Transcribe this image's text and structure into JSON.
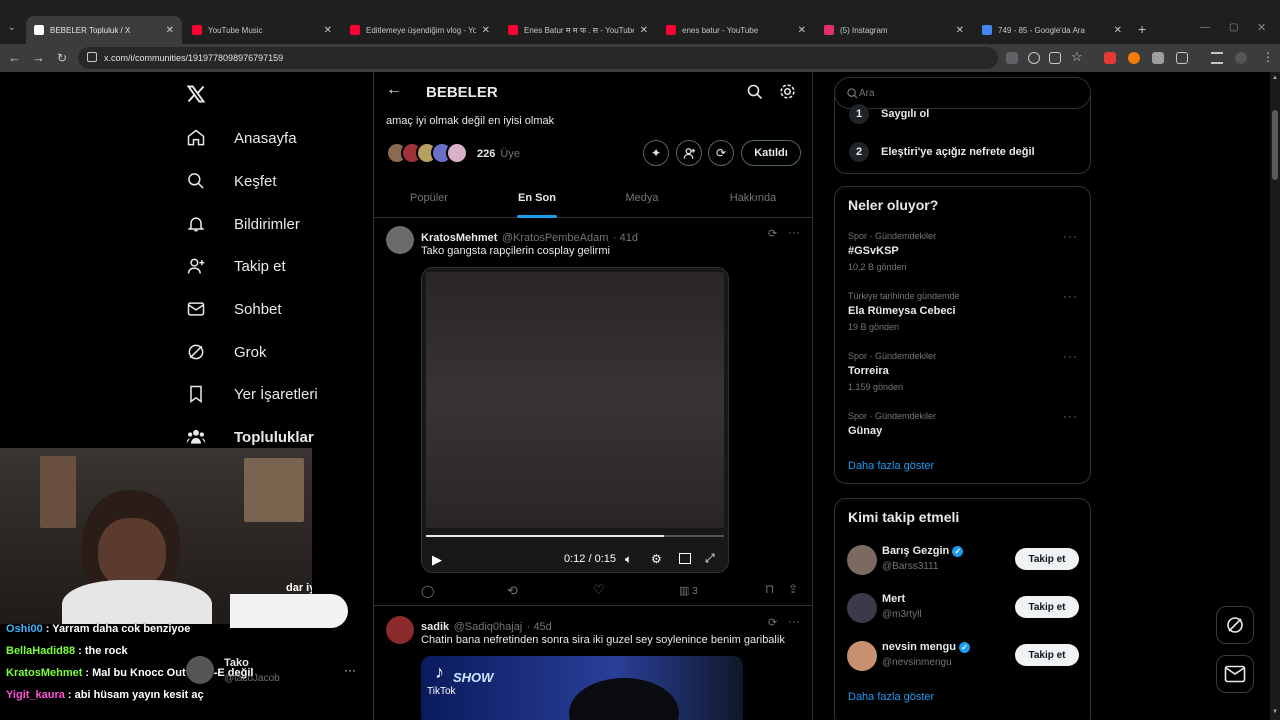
{
  "browser": {
    "tabs": [
      {
        "title": "BEBELER Topluluk / X",
        "favicon_color": "#ffffff",
        "active": true
      },
      {
        "title": "YouTube Music",
        "favicon_color": "#ff0033",
        "active": false
      },
      {
        "title": "Editlemeye üşendiğim vlog - Yo",
        "favicon_color": "#ff0033",
        "active": false
      },
      {
        "title": "Enes Batur म म फ . स - YouTube",
        "favicon_color": "#ff0033",
        "active": false
      },
      {
        "title": "enes batur - YouTube",
        "favicon_color": "#ff0033",
        "active": false
      },
      {
        "title": "(5) Instagram",
        "favicon_color": "#e1306c",
        "active": false
      },
      {
        "title": "749 - 85 - Google'da Ara",
        "favicon_color": "#4285f4",
        "active": false
      }
    ],
    "url": "x.com/i/communities/1919778098976797159"
  },
  "nav": {
    "items": [
      {
        "label": "Anasayfa",
        "icon": "home-icon"
      },
      {
        "label": "Keşfet",
        "icon": "search-icon"
      },
      {
        "label": "Bildirimler",
        "icon": "bell-icon"
      },
      {
        "label": "Takip et",
        "icon": "person-add-icon"
      },
      {
        "label": "Sohbet",
        "icon": "mail-icon"
      },
      {
        "label": "Grok",
        "icon": "grok-icon"
      },
      {
        "label": "Yer İşaretleri",
        "icon": "bookmark-icon"
      },
      {
        "label": "Topluluklar",
        "icon": "communities-icon"
      }
    ]
  },
  "community": {
    "name": "BEBELER",
    "description": "amaç iyi olmak değil en iyisi olmak",
    "member_count": "226",
    "member_label": "Üye",
    "joined_label": "Katıldı",
    "tabs": [
      "Popüler",
      "En Son",
      "Medya",
      "Hakkında"
    ],
    "active_tab": "En Son"
  },
  "posts": [
    {
      "name": "KratosMehmet",
      "handle": "@KratosPembeAdam",
      "time": "· 41d",
      "text": "Tako gangsta rapçilerin cosplay gelirmi",
      "video_time": "0:12 / 0:15",
      "video_progress": 0.8,
      "views": "3"
    },
    {
      "name": "sadik",
      "handle": "@Sadiq0hajaj",
      "time": "· 45d",
      "text": "Chatin bana nefretinden sonra sira iki guzel sey soylenince benim garibalik",
      "media_label_1": "TikTok",
      "media_label_2": "SHOW"
    }
  ],
  "search": {
    "placeholder": "Ara"
  },
  "rules": [
    {
      "num": "1",
      "text": "Saygılı ol"
    },
    {
      "num": "2",
      "text": "Eleştiri'ye açığız nefrete değil"
    }
  ],
  "trends": {
    "title": "Neler oluyor?",
    "items": [
      {
        "meta": "Spor · Gündemdekiler",
        "title": "#GSvKSP",
        "count": "10,2 B gönderi"
      },
      {
        "meta": "Türkiye tarihinde gündemde",
        "title": "Ela Rümeysa Cebeci",
        "count": "19 B gönderi"
      },
      {
        "meta": "Spor · Gündemdekiler",
        "title": "Torreira",
        "count": "1.159 gönderi"
      },
      {
        "meta": "Spor · Gündemdekiler",
        "title": "Günay",
        "count": ""
      }
    ],
    "show_more": "Daha fazla göster"
  },
  "who_to_follow": {
    "title": "Kimi takip etmeli",
    "users": [
      {
        "name": "Barış Gezgin",
        "handle": "@Barss3111",
        "verified": true
      },
      {
        "name": "Mert",
        "handle": "@m3rtyll",
        "verified": false
      },
      {
        "name": "nevsin mengu",
        "handle": "@nevsinmengu",
        "verified": true
      }
    ],
    "follow_label": "Takip et",
    "show_more": "Daha fazla göster"
  },
  "stream_overlay": {
    "partial_text": "dar iyi",
    "chat": [
      {
        "user": "Oshi00",
        "color": "#3fb6ff",
        "message": ": Yarram daha cok benziyoe"
      },
      {
        "user": "BellaHadid88",
        "color": "#7cff3a",
        "message": ": the rock"
      },
      {
        "user": "KratosMehmet",
        "color": "#7cff3a",
        "message": ": Mal bu Knocc Out Eazy-E değil"
      },
      {
        "user": "Yigit_kaura",
        "color": "#ff4fd8",
        "message": ": abi hüsam yayın kesit aç"
      }
    ],
    "account_name": "Tako",
    "account_handle": "@tacoJacob"
  }
}
